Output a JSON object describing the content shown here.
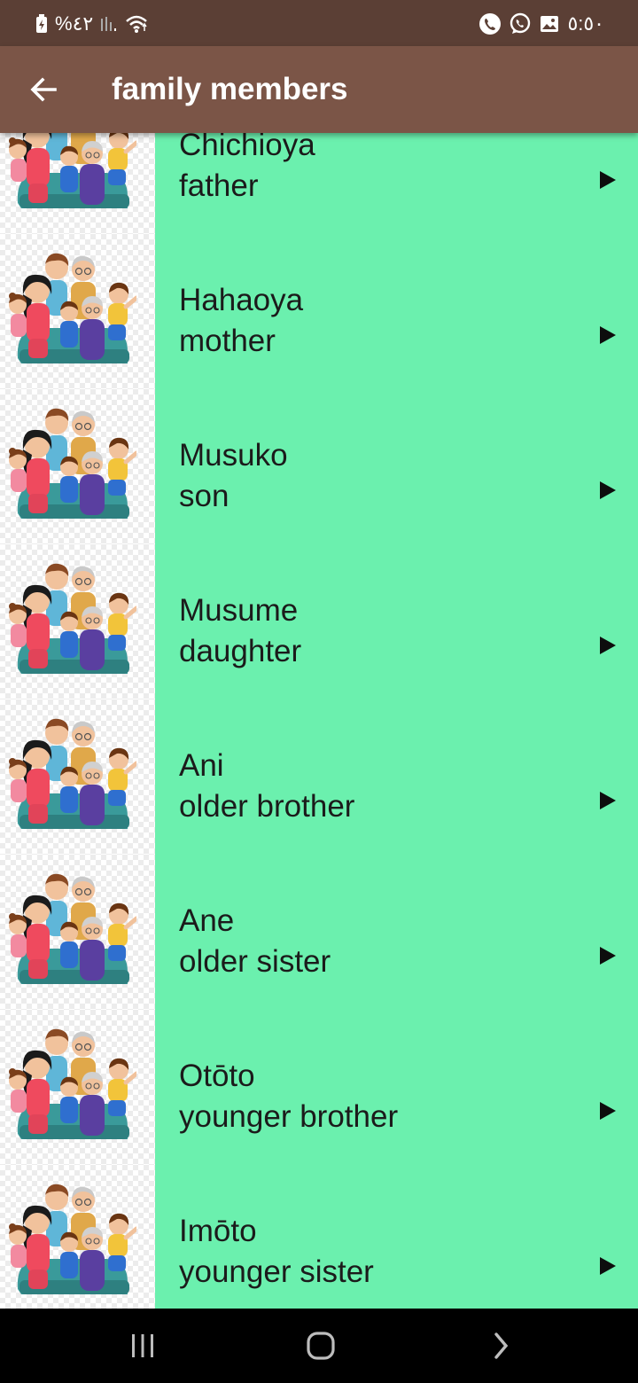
{
  "status_bar": {
    "left_text": "%٤٢",
    "time": "٥:٥٠",
    "icons_left": [
      "battery-saver-icon",
      "signal-icon",
      "wifi-icon"
    ],
    "icons_right": [
      "phone-call-icon",
      "whatsapp-icon",
      "gallery-icon"
    ]
  },
  "app_bar": {
    "title": "family members",
    "back_icon": "arrow-back-icon"
  },
  "list": {
    "items": [
      {
        "romaji": "Chichioya",
        "english": "father"
      },
      {
        "romaji": "Hahaoya",
        "english": "mother"
      },
      {
        "romaji": "Musuko",
        "english": "son"
      },
      {
        "romaji": "Musume",
        "english": "daughter"
      },
      {
        "romaji": "Ani",
        "english": "older brother"
      },
      {
        "romaji": "Ane",
        "english": "older sister"
      },
      {
        "romaji": "Otōto",
        "english": "younger brother"
      },
      {
        "romaji": "Imōto",
        "english": "younger sister"
      }
    ],
    "item_icon": "play-arrow-icon",
    "thumbnail": "family-illustration"
  },
  "nav_bar": {
    "icons": [
      "recent-apps-icon",
      "home-icon",
      "back-nav-icon"
    ]
  },
  "colors": {
    "status_bar": "#5b3f35",
    "app_bar": "#7b5547",
    "item_background": "#6bf0ae",
    "item_text": "#1b1b1b"
  }
}
